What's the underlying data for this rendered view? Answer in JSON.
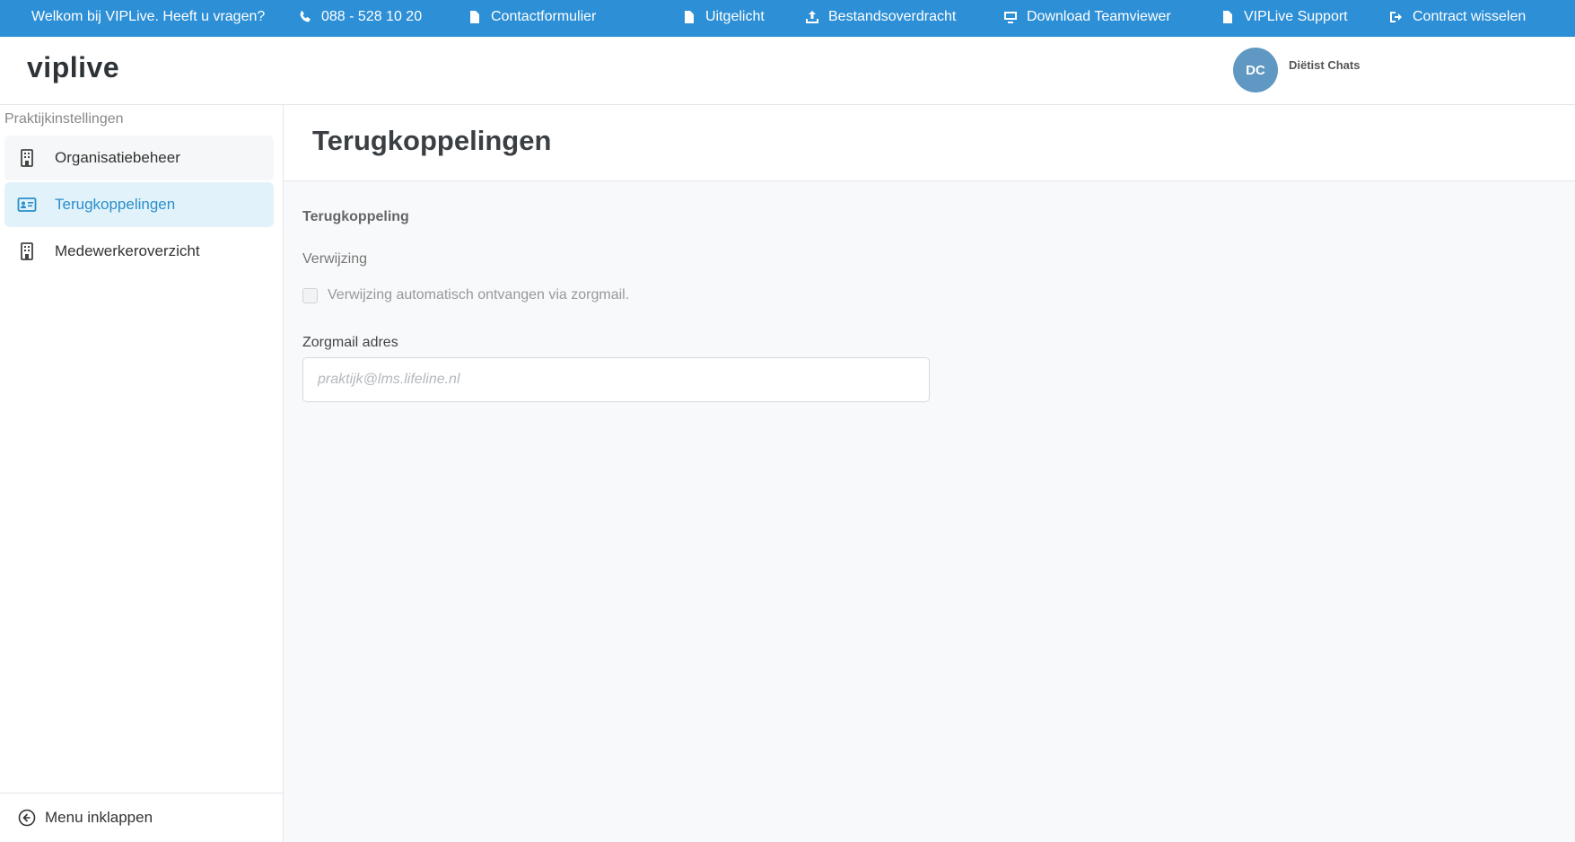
{
  "topbar": {
    "welcome": "Welkom bij VIPLive. Heeft u vragen?",
    "phone": "088 - 528 10 20",
    "contact_form": "Contactformulier",
    "featured": "Uitgelicht",
    "file_transfer": "Bestandsoverdracht",
    "teamviewer": "Download Teamviewer",
    "support": "VIPLive Support",
    "switch_contract": "Contract wisselen"
  },
  "header": {
    "logo": "viplive",
    "avatar_initials": "DC",
    "user_name": "Diëtist Chats"
  },
  "sidebar": {
    "title": "Praktijkinstellingen",
    "items": [
      {
        "label": "Organisatiebeheer",
        "icon": "building-icon"
      },
      {
        "label": "Terugkoppelingen",
        "icon": "id-card-icon",
        "active": true
      },
      {
        "label": "Medewerkeroverzicht",
        "icon": "building-icon"
      }
    ],
    "collapse_label": "Menu inklappen"
  },
  "main": {
    "title": "Terugkoppelingen",
    "section_title": "Terugkoppeling",
    "sub_label": "Verwijzing",
    "checkbox_label": "Verwijzing automatisch ontvangen via zorgmail.",
    "checkbox_checked": false,
    "field_label": "Zorgmail adres",
    "field_placeholder": "praktijk@lms.lifeline.nl",
    "field_value": ""
  },
  "colors": {
    "topbar": "#2d8fd5",
    "active_bg": "#e1f2fb",
    "active_text": "#2a8fc9",
    "avatar": "#5f98c2"
  }
}
